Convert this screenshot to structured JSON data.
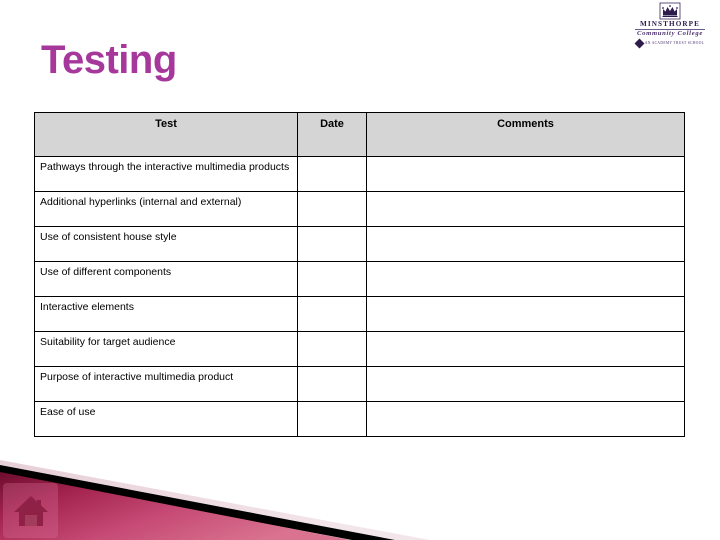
{
  "slide": {
    "title": "Testing",
    "title_color": "#a6389c",
    "background_color": "#ffffff"
  },
  "logo": {
    "name": "MINSTHORPE",
    "subtitle": "Community College",
    "tagline": "AN ACADEMY TRUST SCHOOL",
    "crown_icon": "crown-icon",
    "color": "#2d1b4e"
  },
  "table": {
    "header_background": "#d5d5d5",
    "border_color": "#000000",
    "columns": [
      {
        "key": "test",
        "label": "Test"
      },
      {
        "key": "date",
        "label": "Date"
      },
      {
        "key": "comments",
        "label": "Comments"
      }
    ],
    "rows": [
      {
        "test": "Pathways through the interactive multimedia products",
        "date": "",
        "comments": ""
      },
      {
        "test": "Additional hyperlinks (internal and external)",
        "date": "",
        "comments": ""
      },
      {
        "test": "Use of consistent house style",
        "date": "",
        "comments": ""
      },
      {
        "test": "Use of different components",
        "date": "",
        "comments": ""
      },
      {
        "test": "Interactive elements",
        "date": "",
        "comments": ""
      },
      {
        "test": "Suitability for target audience",
        "date": "",
        "comments": ""
      },
      {
        "test": "Purpose of interactive multimedia product",
        "date": "",
        "comments": ""
      },
      {
        "test": "Ease of use",
        "date": "",
        "comments": ""
      }
    ]
  },
  "footer": {
    "home_button_icon": "home-icon",
    "banner_colors": {
      "crimson_dark": "#7d0f33",
      "crimson": "#b52a5c",
      "pink": "#d4718f",
      "black": "#000000",
      "pale_pink": "#ead6dc"
    }
  }
}
